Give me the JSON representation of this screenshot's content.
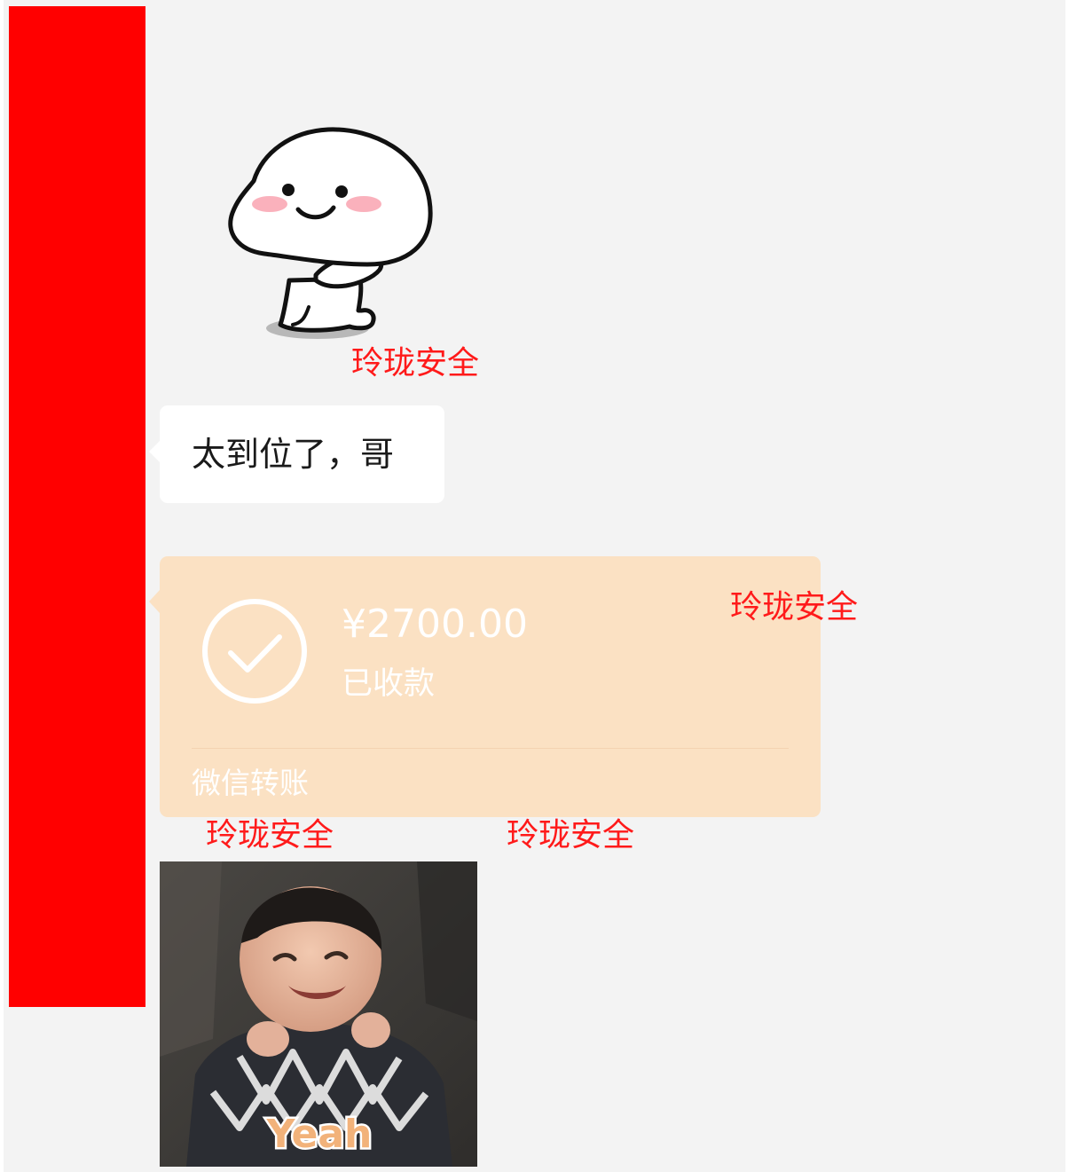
{
  "message_text": "太到位了，哥",
  "transfer": {
    "amount": "¥2700.00",
    "status": "已收款",
    "label": "微信转账",
    "icon": "check-circle-icon",
    "color": "#fbe1c3"
  },
  "watermark": "玲珑安全",
  "sticker_icon": "smiling-round-head-sticker-icon",
  "photo_caption": "Yeah",
  "redaction_color": "#ff0000"
}
